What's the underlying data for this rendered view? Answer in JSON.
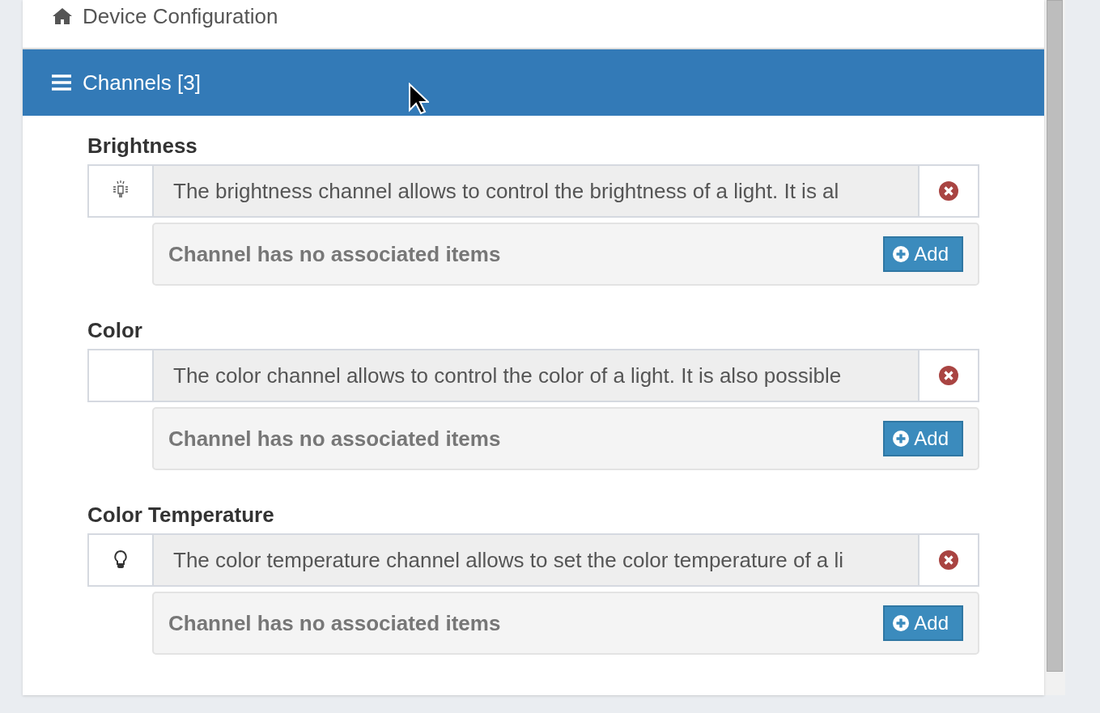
{
  "breadcrumb": {
    "label": "Device Configuration"
  },
  "section": {
    "title": "Channels [3]",
    "expanded": true
  },
  "channels": [
    {
      "name": "Brightness",
      "kind": "brightness",
      "description": "The brightness channel allows to control the brightness of a light. It is al",
      "items_message": "Channel has no associated items",
      "add_label": "Add"
    },
    {
      "name": "Color",
      "kind": "plain",
      "description": "The color channel allows to control the color of a light. It is also possible",
      "items_message": "Channel has no associated items",
      "add_label": "Add"
    },
    {
      "name": "Color Temperature",
      "kind": "bulb",
      "description": "The color temperature channel allows to set the color temperature of a li",
      "items_message": "Channel has no associated items",
      "add_label": "Add"
    }
  ]
}
